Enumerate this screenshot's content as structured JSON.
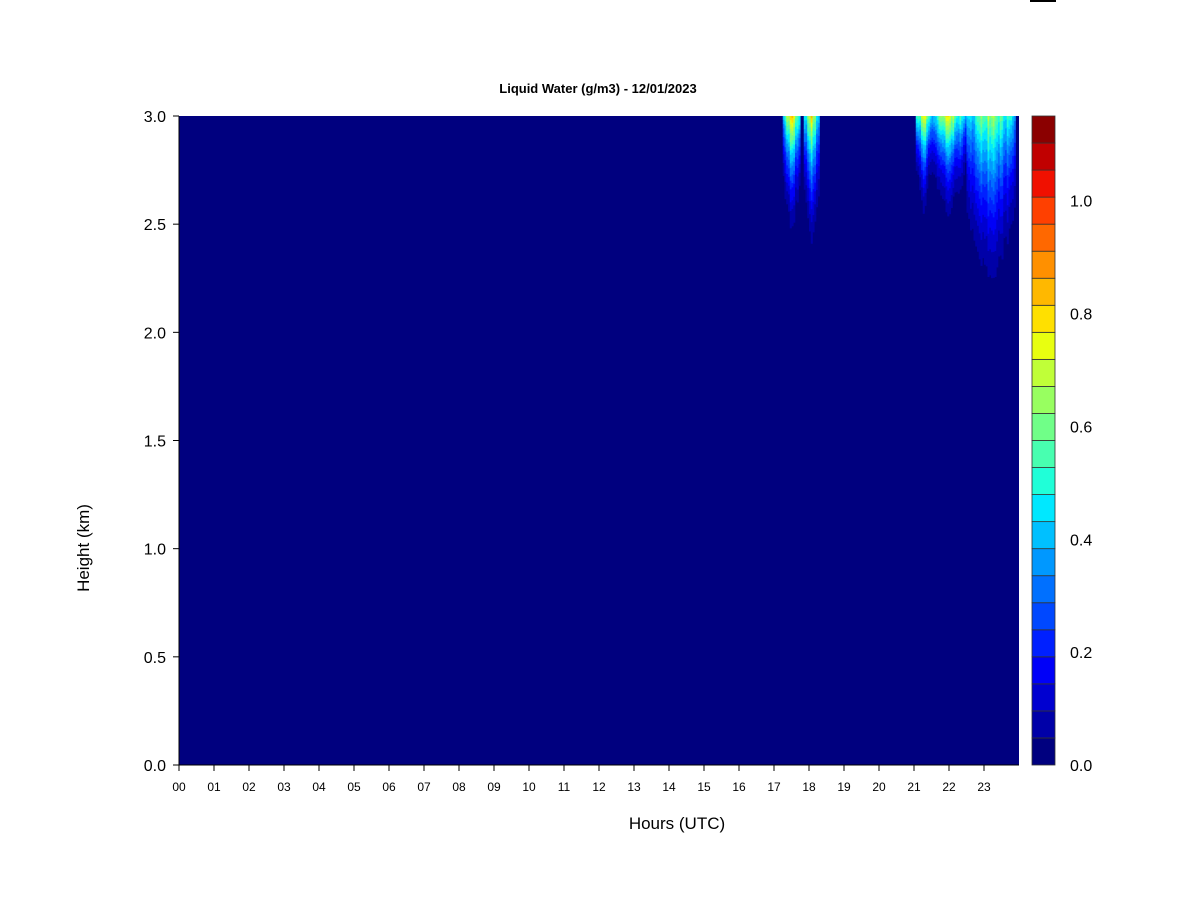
{
  "chart_data": {
    "type": "heatmap",
    "title": "Liquid Water (g/m3) - 12/01/2023",
    "xlabel": "Hours (UTC)",
    "ylabel": "Height (km)",
    "xlim": [
      0,
      24
    ],
    "ylim": [
      0,
      3.0
    ],
    "x_ticks": [
      "00",
      "01",
      "02",
      "03",
      "04",
      "05",
      "06",
      "07",
      "08",
      "09",
      "10",
      "11",
      "12",
      "13",
      "14",
      "15",
      "16",
      "17",
      "18",
      "19",
      "20",
      "21",
      "22",
      "23"
    ],
    "y_ticks": [
      "0.0",
      "0.5",
      "1.0",
      "1.5",
      "2.0",
      "2.5",
      "3.0"
    ],
    "colorbar": {
      "min": 0.0,
      "max": 1.15,
      "step": 0.05,
      "tick_labels": [
        "0.0",
        "0.2",
        "0.4",
        "0.6",
        "0.8",
        "1.0"
      ],
      "tick_values": [
        0.0,
        0.2,
        0.4,
        0.6,
        0.8,
        1.0
      ],
      "colors": [
        "#00007f",
        "#0000a8",
        "#0000d0",
        "#0000f8",
        "#0020ff",
        "#0048ff",
        "#0070ff",
        "#0098ff",
        "#00c0ff",
        "#00e8ff",
        "#20ffd8",
        "#48ffb0",
        "#70ff88",
        "#98ff60",
        "#c0ff38",
        "#e8ff10",
        "#ffe000",
        "#ffb800",
        "#ff9000",
        "#ff6800",
        "#ff4000",
        "#f01000",
        "#c00000",
        "#8b0000"
      ]
    },
    "background_value": 0.0,
    "cloud_events": [
      {
        "time_start": 17.25,
        "time_end": 17.75,
        "base_height": 2.2,
        "peak_value": 1.0
      },
      {
        "time_start": 17.85,
        "time_end": 18.3,
        "base_height": 2.1,
        "peak_value": 0.9
      },
      {
        "time_start": 21.05,
        "time_end": 21.5,
        "base_height": 2.35,
        "peak_value": 0.95
      },
      {
        "time_start": 21.5,
        "time_end": 22.5,
        "base_height": 2.3,
        "peak_value": 0.9
      },
      {
        "time_start": 22.5,
        "time_end": 23.9,
        "base_height": 1.8,
        "peak_value": 0.85
      }
    ]
  }
}
